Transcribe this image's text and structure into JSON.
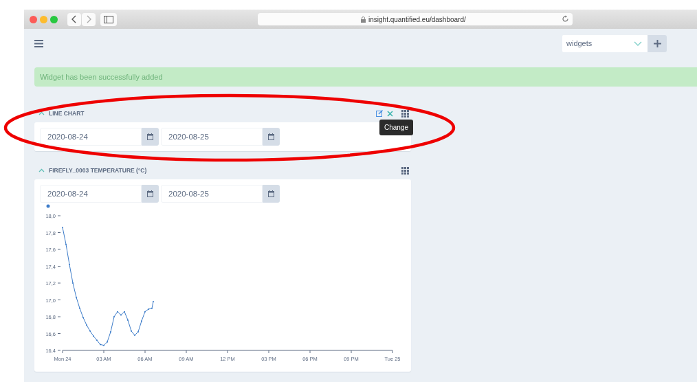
{
  "browser": {
    "url": "insight.quantified.eu/dashboard/"
  },
  "toolbar": {
    "select": {
      "value": "widgets"
    }
  },
  "alert": {
    "message": "Widget has been successfully added"
  },
  "widgets": [
    {
      "title": "LINE CHART",
      "expanded": true,
      "editable": true,
      "tooltip": "Change",
      "date_from": "2020-08-24",
      "date_to": "2020-08-25"
    },
    {
      "title": "FIREFLY_0003 TEMPERATURE (°C)",
      "expanded": true,
      "editable": false,
      "date_from": "2020-08-24",
      "date_to": "2020-08-25",
      "chart_data": {
        "type": "line",
        "x": [
          "2020-08-24T00:00",
          "2020-08-24T00:15",
          "2020-08-24T00:30",
          "2020-08-24T00:45",
          "2020-08-24T01:00",
          "2020-08-24T01:15",
          "2020-08-24T01:30",
          "2020-08-24T01:45",
          "2020-08-24T02:00",
          "2020-08-24T02:15",
          "2020-08-24T02:30",
          "2020-08-24T02:45",
          "2020-08-24T03:00",
          "2020-08-24T03:15",
          "2020-08-24T03:30",
          "2020-08-24T03:45",
          "2020-08-24T04:00",
          "2020-08-24T04:15",
          "2020-08-24T04:30",
          "2020-08-24T04:45",
          "2020-08-24T05:00",
          "2020-08-24T05:15",
          "2020-08-24T05:30",
          "2020-08-24T05:45",
          "2020-08-24T06:00",
          "2020-08-24T06:15",
          "2020-08-24T06:30",
          "2020-08-24T06:36"
        ],
        "series": [
          {
            "color": "#3d7cc9",
            "values": [
              17.86,
              17.66,
              17.42,
              17.2,
              17.03,
              16.9,
              16.79,
              16.7,
              16.63,
              16.57,
              16.52,
              16.47,
              16.46,
              16.5,
              16.62,
              16.8,
              16.86,
              16.82,
              16.86,
              16.76,
              16.63,
              16.58,
              16.62,
              16.75,
              16.86,
              16.89,
              16.9,
              16.98
            ]
          }
        ],
        "xlim": [
          "2020-08-24T00:00",
          "2020-08-25T00:00"
        ],
        "ylim": [
          16.4,
          18.0
        ],
        "xticks": [
          {
            "value": "2020-08-24T00:00",
            "label": "Mon 24"
          },
          {
            "value": "2020-08-24T03:00",
            "label": "03 AM"
          },
          {
            "value": "2020-08-24T06:00",
            "label": "06 AM"
          },
          {
            "value": "2020-08-24T09:00",
            "label": "09 AM"
          },
          {
            "value": "2020-08-24T12:00",
            "label": "12 PM"
          },
          {
            "value": "2020-08-24T15:00",
            "label": "03 PM"
          },
          {
            "value": "2020-08-24T18:00",
            "label": "06 PM"
          },
          {
            "value": "2020-08-24T21:00",
            "label": "09 PM"
          },
          {
            "value": "2020-08-25T00:00",
            "label": "Tue 25"
          }
        ],
        "yticks": [
          {
            "value": 16.4,
            "label": "16,4"
          },
          {
            "value": 16.6,
            "label": "16,6"
          },
          {
            "value": 16.8,
            "label": "16,8"
          },
          {
            "value": 17.0,
            "label": "17,0"
          },
          {
            "value": 17.2,
            "label": "17,2"
          },
          {
            "value": 17.4,
            "label": "17,4"
          },
          {
            "value": 17.6,
            "label": "17,6"
          },
          {
            "value": 17.8,
            "label": "17,8"
          },
          {
            "value": 18.0,
            "label": "18,0"
          }
        ]
      }
    }
  ]
}
